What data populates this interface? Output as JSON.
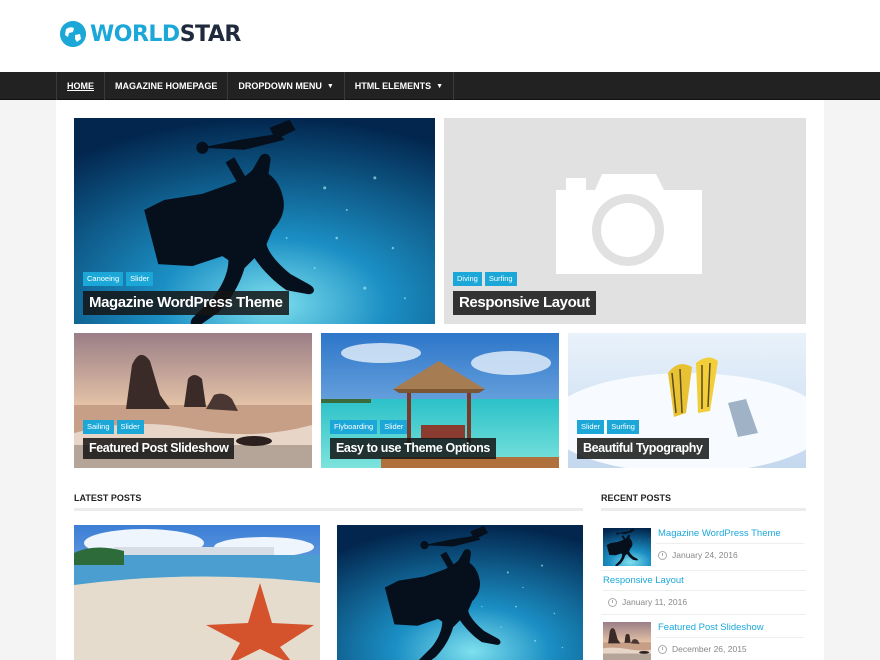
{
  "site": {
    "logo_part1": "WORLD",
    "logo_part2": "STAR",
    "accent": "#1ba8d9"
  },
  "nav": {
    "items": [
      {
        "label": "HOME",
        "active": true
      },
      {
        "label": "MAGAZINE HOMEPAGE"
      },
      {
        "label": "DROPDOWN MENU",
        "has_dropdown": true
      },
      {
        "label": "HTML ELEMENTS",
        "has_dropdown": true
      }
    ]
  },
  "featured": [
    {
      "title": "Magazine WordPress Theme",
      "categories": [
        "Canoeing",
        "Slider"
      ],
      "image": "diver"
    },
    {
      "title": "Responsive Layout",
      "categories": [
        "Diving",
        "Surfing"
      ],
      "image": "camera-placeholder"
    },
    {
      "title": "Featured Post Slideshow",
      "categories": [
        "Sailing",
        "Slider"
      ],
      "image": "rocks-beach"
    },
    {
      "title": "Easy to use Theme Options",
      "categories": [
        "Flyboarding",
        "Slider"
      ],
      "image": "beach-hut"
    },
    {
      "title": "Beautiful Typography",
      "categories": [
        "Slider",
        "Surfing"
      ],
      "image": "flippers"
    }
  ],
  "latest_posts": {
    "heading": "LATEST POSTS",
    "thumbs": [
      "starfish-beach",
      "diver"
    ]
  },
  "recent_posts": {
    "heading": "RECENT POSTS",
    "items": [
      {
        "title": "Magazine WordPress Theme",
        "date": "January 24, 2016",
        "thumb": "diver"
      },
      {
        "title": "Responsive Layout",
        "date": "January 11, 2016",
        "thumb": null
      },
      {
        "title": "Featured Post Slideshow",
        "date": "December 26, 2015",
        "thumb": "rocks-beach"
      }
    ]
  }
}
